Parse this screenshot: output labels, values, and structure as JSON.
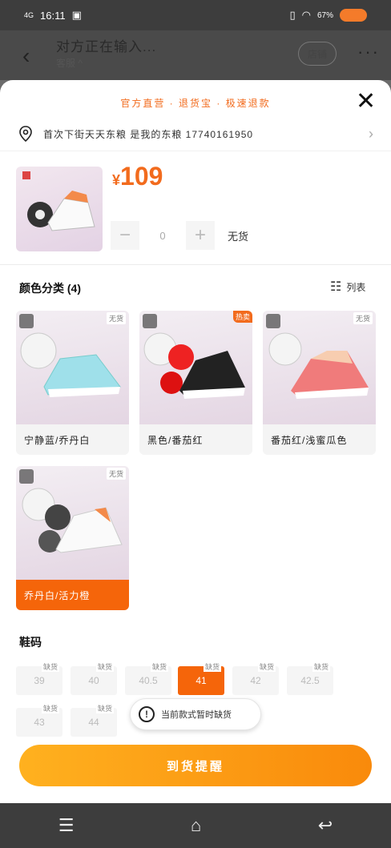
{
  "status_bar": {
    "signal": "4G",
    "time": "16:11",
    "battery_pct": "67%",
    "battery_color": "#f47b2a"
  },
  "header": {
    "title": "对方正在输入...",
    "subtitle": "客服 ^",
    "shop_label": "店铺"
  },
  "sheet": {
    "promo_text": "官方直营 · 退货宝 · 极速退款",
    "address": "首次下街天天东粮 是我的东粮 17740161950",
    "price_symbol": "¥",
    "price": "109",
    "quantity": "0",
    "stock_status": "无货",
    "color_section_title": "颜色分类 (4)",
    "list_view_label": "列表",
    "colors": [
      {
        "label": "宁静蓝/乔丹白",
        "tag": "无货",
        "selected": false
      },
      {
        "label": "黑色/番茄红",
        "tag": "热卖",
        "selected": false
      },
      {
        "label": "番茄红/浅蜜瓜色",
        "tag": "无货",
        "selected": false
      },
      {
        "label": "乔丹白/活力橙",
        "tag": "无货",
        "selected": true
      }
    ],
    "size_section_title": "鞋码",
    "sizes": [
      {
        "label": "39",
        "tag": "缺货",
        "selected": false
      },
      {
        "label": "40",
        "tag": "缺货",
        "selected": false
      },
      {
        "label": "40.5",
        "tag": "缺货",
        "selected": false
      },
      {
        "label": "41",
        "tag": "缺货",
        "selected": true
      },
      {
        "label": "42",
        "tag": "缺货",
        "selected": false
      },
      {
        "label": "42.5",
        "tag": "缺货",
        "selected": false
      },
      {
        "label": "43",
        "tag": "缺货",
        "selected": false
      },
      {
        "label": "44",
        "tag": "缺货",
        "selected": false
      }
    ],
    "toast_text": "当前款式暂时缺货",
    "cta_label": "到货提醒",
    "accent_color": "#f5650a"
  },
  "system_nav": {
    "menu": "☰",
    "home": "⌂",
    "back": "↩"
  }
}
